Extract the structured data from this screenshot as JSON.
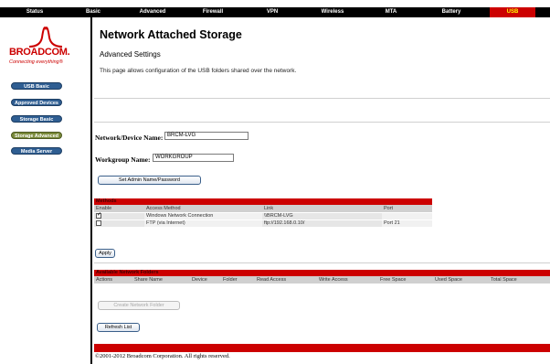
{
  "nav": {
    "items": [
      "Status",
      "Basic",
      "Advanced",
      "Firewall",
      "VPN",
      "Wireless",
      "MTA",
      "Battery",
      "USB"
    ],
    "active": "USB"
  },
  "brand": {
    "name": "BROADCOM.",
    "tagline": "Connecting everything®",
    "color": "#cc0000"
  },
  "sidebar": {
    "items": [
      "USB Basic",
      "Approved Devices",
      "Storage Basic",
      "Storage Advanced",
      "Media Server"
    ],
    "active": "Storage Advanced"
  },
  "page": {
    "title": "Network Attached Storage",
    "subtitle": "Advanced Settings",
    "description": "This page allows configuration of the USB folders shared over the network."
  },
  "form": {
    "device_name_label": "Network/Device Name:",
    "device_name_value": "BRCM-LVG",
    "workgroup_label": "Workgroup Name:",
    "workgroup_value": "WORKGROUP",
    "admin_button": "Set Admin Name/Password"
  },
  "methods": {
    "title": "Methods",
    "headers": [
      "Enable",
      "Access Method",
      "Link",
      "Port"
    ],
    "rows": [
      {
        "enabled": true,
        "method": "Windows Network Connection",
        "link": "\\\\BRCM-LVG",
        "port": ""
      },
      {
        "enabled": false,
        "method": "FTP (via Internet)",
        "link": "ftp://192.168.0.10/",
        "port": "Port 21"
      }
    ],
    "apply_button": "Apply"
  },
  "folders": {
    "title": "Available Network Folders",
    "headers": [
      "Actions",
      "Share Name",
      "Device",
      "Folder",
      "Read Access",
      "Write Access",
      "Free Space",
      "Used Space",
      "Total Space"
    ],
    "create_button": "Create Network Folder",
    "refresh_button": "Refresh List"
  },
  "footer": {
    "copyright": "©2001-2012 Broadcom Corporation. All rights reserved."
  },
  "colors": {
    "accent_red": "#cc0000",
    "nav_bg": "#000000",
    "sidebar_button": "#2f5e92",
    "sidebar_active": "#7a8a3a"
  }
}
